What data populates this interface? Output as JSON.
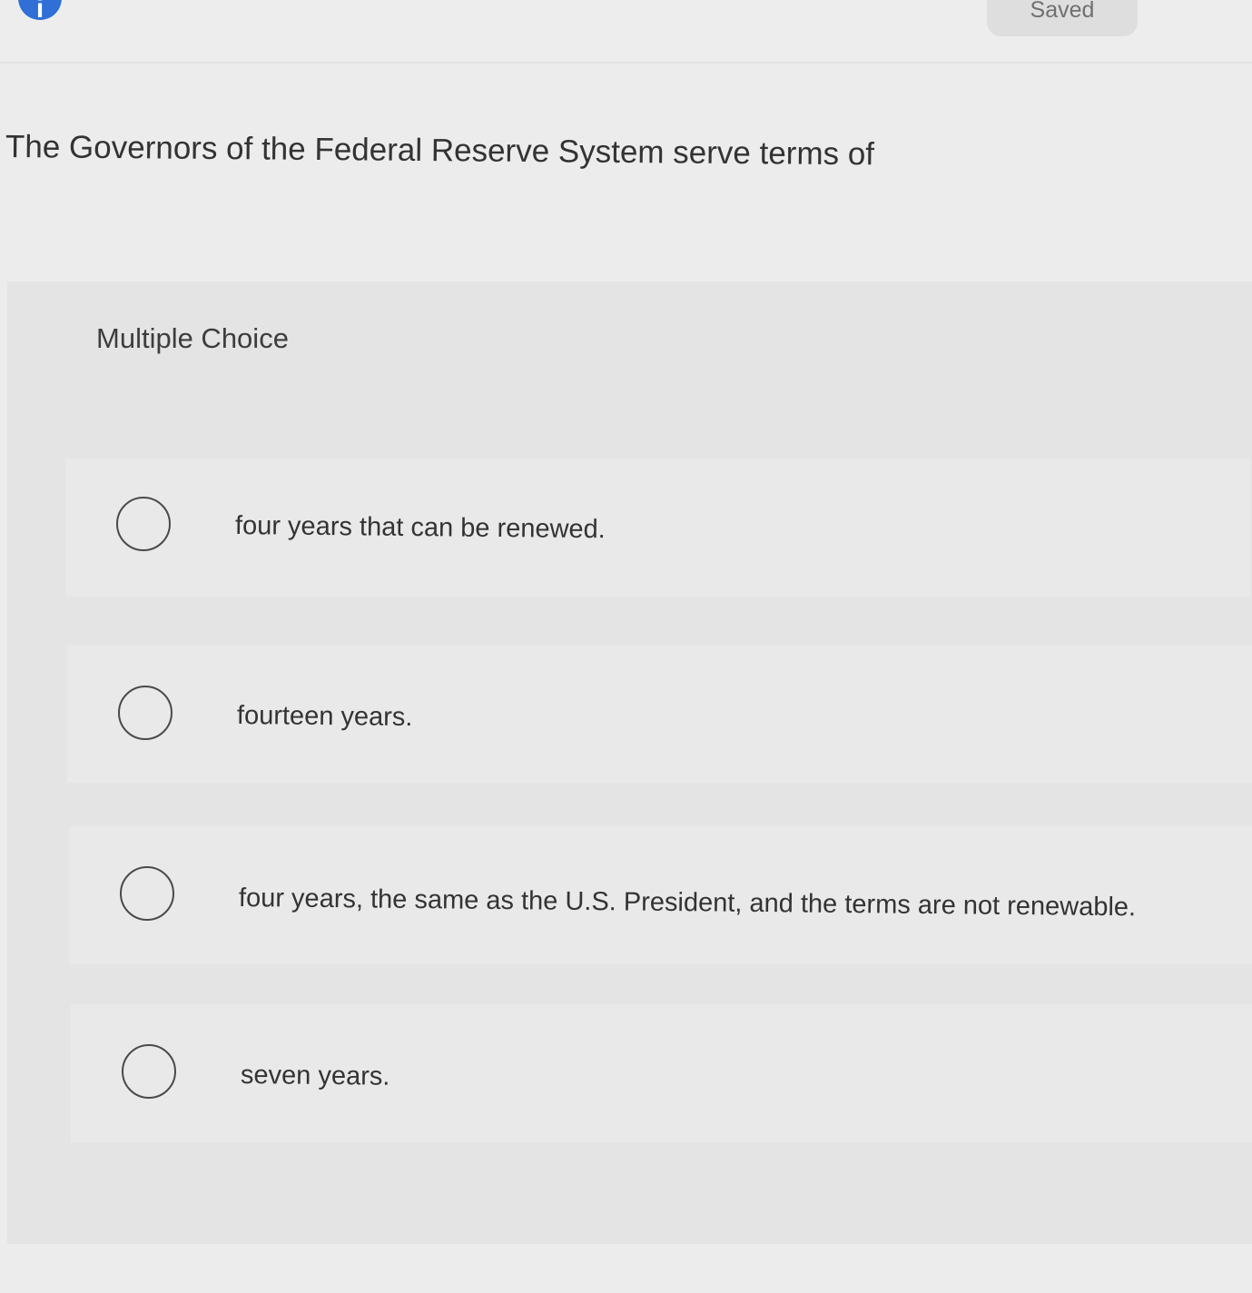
{
  "header": {
    "info_icon_glyph": "i",
    "saved_label": "Saved"
  },
  "question": {
    "text": "The Governors of the Federal Reserve System serve terms of"
  },
  "choices": {
    "heading": "Multiple Choice",
    "options": [
      {
        "label": "four years that can be renewed."
      },
      {
        "label": "fourteen years."
      },
      {
        "label": "four years, the same as the U.S. President, and the terms are not renewable."
      },
      {
        "label": "seven years."
      }
    ]
  },
  "colors": {
    "info_icon": "#2f6fd6",
    "background": "#ececec",
    "panel": "#e4e4e4"
  }
}
